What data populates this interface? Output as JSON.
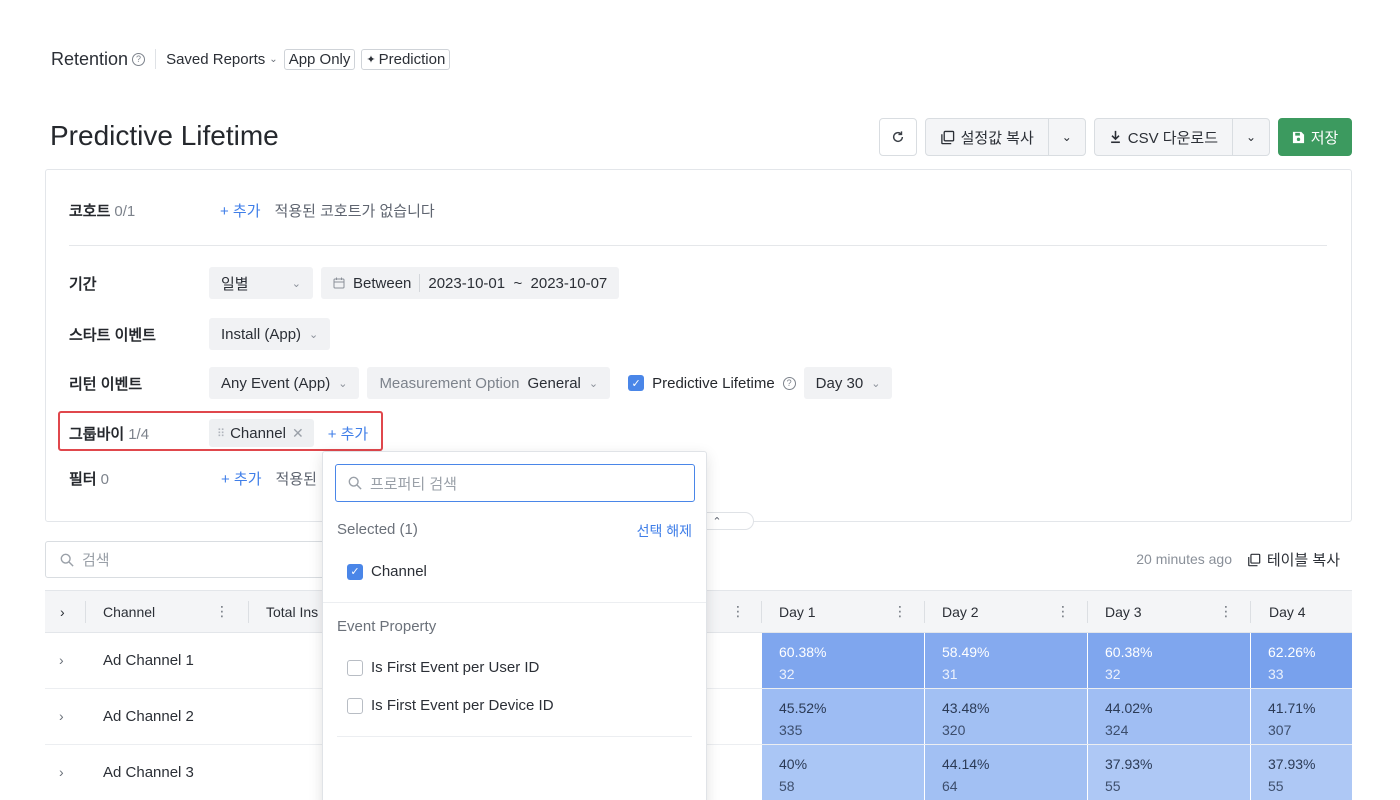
{
  "topnav": {
    "title": "Retention",
    "saved_reports": "Saved Reports",
    "app_only": "App Only",
    "prediction": "Prediction"
  },
  "page": {
    "title": "Predictive Lifetime"
  },
  "toolbar": {
    "copy_settings": "설정값 복사",
    "csv_download": "CSV 다운로드",
    "save": "저장"
  },
  "settings": {
    "cohort": {
      "label": "코호트",
      "count": "0/1",
      "add": "+ 추가",
      "empty": "적용된 코호트가 없습니다"
    },
    "period": {
      "label": "기간",
      "granularity": "일별",
      "between": "Between",
      "range": "2023-10-01  ~  2023-10-07"
    },
    "start_event": {
      "label": "스타트 이벤트",
      "value": "Install (App)"
    },
    "return_event": {
      "label": "리턴 이벤트",
      "value": "Any Event (App)",
      "measure_label": "Measurement Option",
      "measure_value": "General",
      "predictive_label": "Predictive Lifetime",
      "day_value": "Day 30"
    },
    "group_by": {
      "label": "그룹바이",
      "count": "1/4",
      "tag": "Channel",
      "add": "+ 추가"
    },
    "filter": {
      "label": "필터",
      "count": "0",
      "add": "+ 추가",
      "empty": "적용된 필"
    }
  },
  "search": {
    "placeholder": "검색"
  },
  "meta": {
    "updated": "20 minutes ago",
    "table_copy": "테이블 복사"
  },
  "table": {
    "headers": {
      "channel": "Channel",
      "total": "Total Ins",
      "day1": "Day 1",
      "day2": "Day 2",
      "day3": "Day 3",
      "day4": "Day 4"
    },
    "rows": [
      {
        "name": "Ad Channel 1",
        "cells": [
          {
            "pct": "60.38%",
            "cnt": "32"
          },
          {
            "pct": "58.49%",
            "cnt": "31"
          },
          {
            "pct": "60.38%",
            "cnt": "32"
          },
          {
            "pct": "62.26%",
            "cnt": "33"
          }
        ]
      },
      {
        "name": "Ad Channel 2",
        "cells": [
          {
            "pct": "45.52%",
            "cnt": "335"
          },
          {
            "pct": "43.48%",
            "cnt": "320"
          },
          {
            "pct": "44.02%",
            "cnt": "324"
          },
          {
            "pct": "41.71%",
            "cnt": "307"
          }
        ]
      },
      {
        "name": "Ad Channel 3",
        "cells": [
          {
            "pct": "40%",
            "cnt": "58"
          },
          {
            "pct": "44.14%",
            "cnt": "64"
          },
          {
            "pct": "37.93%",
            "cnt": "55"
          },
          {
            "pct": "37.93%",
            "cnt": "55"
          }
        ]
      }
    ]
  },
  "dropdown": {
    "search_placeholder": "프로퍼티 검색",
    "selected_title": "Selected (1)",
    "clear": "선택 해제",
    "selected_item": "Channel",
    "section": "Event Property",
    "items": [
      "Is First Event per User ID",
      "Is First Event per Device ID"
    ]
  },
  "colors": {
    "accent": "#4a86e8",
    "save_green": "#3c9a5f",
    "highlight_red": "#e0474c",
    "cell_strong": "#7fa6ee",
    "cell_mid": "#97b8f1",
    "cell_light": "#a7c3f4"
  }
}
